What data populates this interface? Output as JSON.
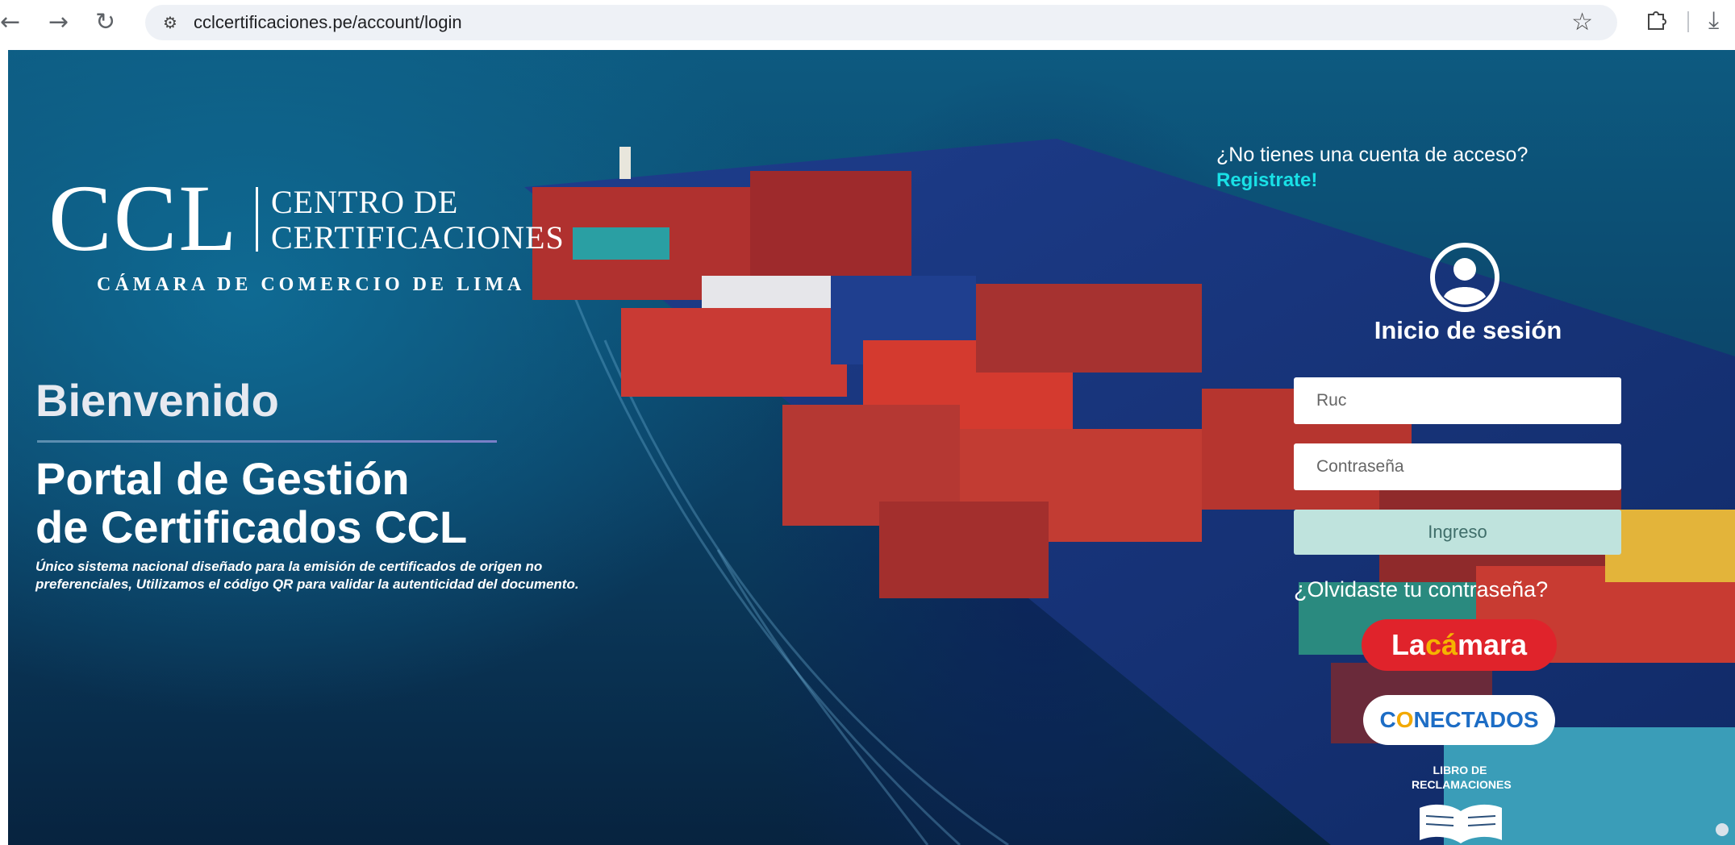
{
  "browser": {
    "back_icon": "back-arrow-icon",
    "forward_icon": "forward-arrow-icon",
    "reload_icon": "reload-icon",
    "url": "cclcertificaciones.pe/account/login",
    "bookmark_icon": "star-icon",
    "extensions_icon": "puzzle-icon",
    "download_icon": "download-icon"
  },
  "brand": {
    "mark": "CCL",
    "line1": "CENTRO DE",
    "line2": "CERTIFICACIONES",
    "subtitle": "CÁMARA DE COMERCIO DE LIMA"
  },
  "intro": {
    "welcome": "Bienvenido",
    "portal_line1": "Portal de Gestión",
    "portal_line2": "de Certificados CCL",
    "tagline": "Único sistema nacional diseñado para la emisión de certificados de origen no preferenciales, Utilizamos el código QR para validar la autenticidad del documento."
  },
  "login": {
    "no_account_prompt": "¿No tienes una cuenta de acceso?",
    "register_link": "Registrate!",
    "title": "Inicio de sesión",
    "ruc_placeholder": "Ruc",
    "password_placeholder": "Contraseña",
    "submit_label": "Ingreso",
    "forgot_link": "¿Olvidaste tu contraseña?"
  },
  "partners": {
    "lacamara_prefix": "La",
    "lacamara_accent": "cá",
    "lacamara_suffix": "mara",
    "conectados_c": "C",
    "conectados_o": "O",
    "conectados_rest": "NECTADOS",
    "libro_line1": "LIBRO DE",
    "libro_line2": "RECLAMACIONES"
  },
  "colors": {
    "register_link": "#19e0e6",
    "login_button": "#bfe3dd",
    "lacamara_red": "#e0232b",
    "conectados_blue": "#1d6dc5"
  }
}
